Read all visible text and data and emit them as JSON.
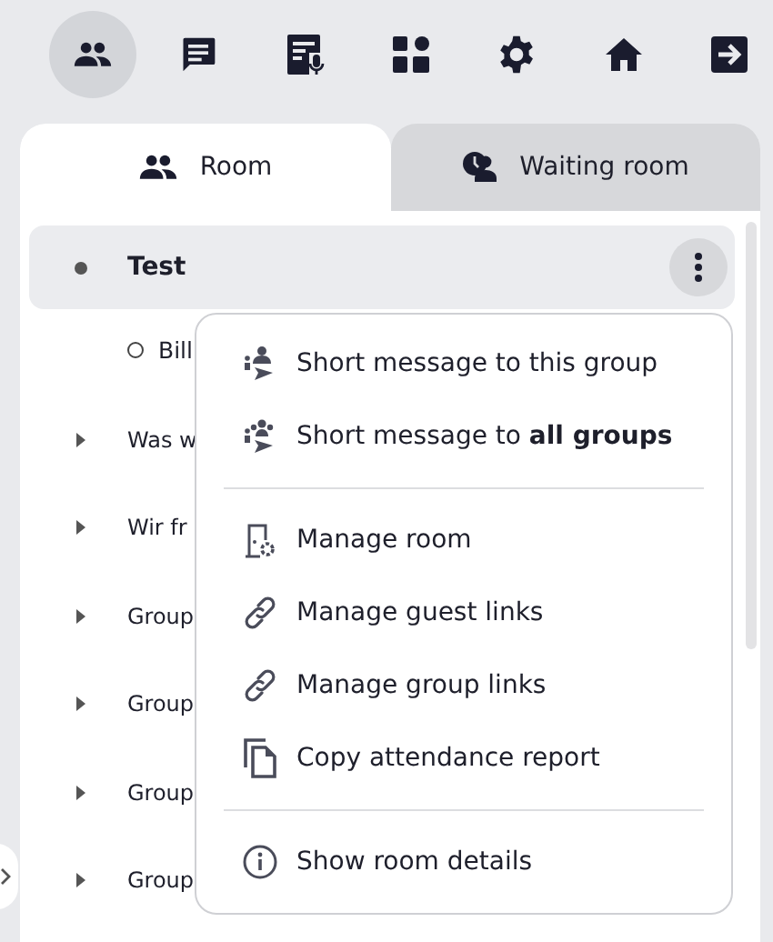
{
  "toolbar": [
    {
      "selected": true
    },
    {
      "selected": false
    },
    {
      "selected": false
    },
    {
      "selected": false
    },
    {
      "selected": false
    },
    {
      "selected": false
    },
    {
      "selected": false
    }
  ],
  "tabs": [
    {
      "label": "Room",
      "selected": true
    },
    {
      "label": "Waiting room",
      "selected": false
    }
  ],
  "groups": [
    {
      "name": "Test",
      "expanded": true,
      "selected": true,
      "children": [
        {
          "name": "Bill"
        }
      ]
    },
    {
      "name": "Was w",
      "expanded": false,
      "selected": false
    },
    {
      "name": "Wir fr",
      "expanded": false,
      "selected": false
    },
    {
      "name": "Group",
      "expanded": false,
      "selected": false
    },
    {
      "name": "Group",
      "expanded": false,
      "selected": false
    },
    {
      "name": "Group",
      "expanded": false,
      "selected": false
    },
    {
      "name": "Group",
      "expanded": false,
      "selected": false
    }
  ],
  "context_menu": [
    {
      "kind": "item",
      "label": "Short message to this group"
    },
    {
      "kind": "item",
      "label": "Short message to **all groups**"
    },
    {
      "kind": "divider"
    },
    {
      "kind": "item",
      "label": "Manage room"
    },
    {
      "kind": "item",
      "label": "Manage guest links"
    },
    {
      "kind": "item",
      "label": "Manage group links"
    },
    {
      "kind": "item",
      "label": "Copy attendance report"
    },
    {
      "kind": "divider"
    },
    {
      "kind": "item",
      "label": "Show room details"
    }
  ]
}
